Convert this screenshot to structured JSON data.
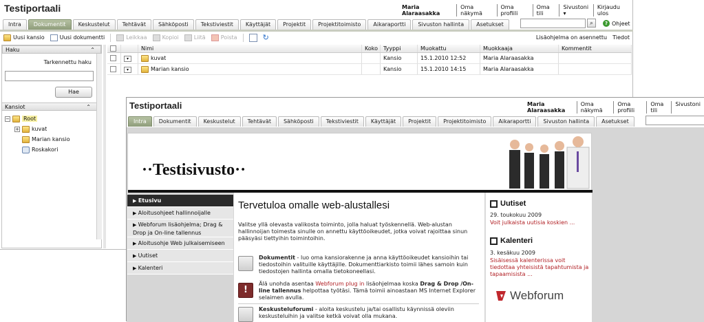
{
  "back": {
    "title": "Testiportaali",
    "user": "Maria Alaraasakka",
    "links": [
      "Oma näkymä",
      "Oma profiili",
      "Oma tili",
      "Sivustoni ▾",
      "Kirjaudu ulos"
    ],
    "tabs": [
      "Intra",
      "Dokumentit",
      "Keskustelut",
      "Tehtävät",
      "Sähköposti",
      "Tekstiviestit",
      "Käyttäjät",
      "Projektit",
      "Projektitoimisto",
      "Aikaraportti",
      "Sivuston hallinta",
      "Asetukset"
    ],
    "active_tab": "Dokumentit",
    "help_label": "Ohjeet",
    "toolbar": {
      "new_folder": "Uusi kansio",
      "new_document": "Uusi dokumentti",
      "cut": "Leikkaa",
      "copy": "Kopioi",
      "paste": "Liitä",
      "delete": "Poista",
      "plugin_status": "Lisäohjelma on asennettu",
      "info": "Tiedot"
    },
    "search_panel": {
      "title": "Haku",
      "advanced": "Tarkennettu haku",
      "search_button": "Hae"
    },
    "folders_panel": {
      "title": "Kansiot",
      "root": "Root",
      "items": [
        "kuvat",
        "Marian kansio",
        "Roskakori"
      ]
    },
    "grid": {
      "columns": [
        "Nimi",
        "Koko",
        "Tyyppi",
        "Muokattu",
        "Muokkaaja",
        "Kommentit"
      ],
      "rows": [
        {
          "name": "kuvat",
          "size": "",
          "type": "Kansio",
          "modified": "15.1.2010 12:52",
          "editor": "Maria Alaraasakka",
          "comment": ""
        },
        {
          "name": "Marian kansio",
          "size": "",
          "type": "Kansio",
          "modified": "15.1.2010 14:15",
          "editor": "Maria Alaraasakka",
          "comment": ""
        }
      ]
    }
  },
  "front": {
    "title": "Testiportaali",
    "user": "Maria Alaraasakka",
    "links": [
      "Oma näkymä",
      "Oma profiili",
      "Oma tili",
      "Sivustoni"
    ],
    "tabs": [
      "Intra",
      "Dokumentit",
      "Keskustelut",
      "Tehtävät",
      "Sähköposti",
      "Tekstiviestit",
      "Käyttäjät",
      "Projektit",
      "Projektitoimisto",
      "Aikaraportti",
      "Sivuston hallinta",
      "Asetukset"
    ],
    "active_tab": "Intra",
    "site_name": "··Testisivusto··",
    "nav": [
      "Etusivu",
      "Aloitusohjeet hallinnoijalle",
      "Webforum lisäohjelma; Drag & Drop ja On-line tallennus",
      "Aloitusohje Web julkaisemiseen",
      "Uutiset",
      "Kalenteri"
    ],
    "welcome_title": "Tervetuloa omalle web-alustallesi",
    "welcome_text": "Valitse yllä olevasta valikosta toiminto, jolla haluat työskennellä. Web-alustan hallinnoijan toimesta sinulle on annettu käyttöoikeudet, jotka voivat rajoittaa sinun pääsyäsi tiettyihin toimintoihin.",
    "sections": [
      {
        "bold": "Dokumentit",
        "text": " - luo oma kansiorakenne ja anna käyttöoikeudet kansioihin tai tiedostoihin valituille käyttäjille. Dokumenttiarkisto toimii lähes samoin kuin tiedostojen hallinta omalla tietokoneellasi."
      },
      {
        "pre": "Älä unohda asentaa ",
        "link": "Webforum plug in",
        "mid": " lisäohjelmaa koska ",
        "bold": "Drag & Drop /On-line tallennus",
        "text": " helpottaa työtäsi. Tämä toimii ainoastaan MS Internet Explorer selaimen avulla."
      },
      {
        "bold": "Keskusteluforumi",
        "text": " - aloita keskustelu ja/tai osallistu käynnissä oleviin keskusteluihin ja valitse ketkä voivat olla mukana."
      }
    ],
    "news": {
      "title": "Uutiset",
      "date": "29. toukokuu 2009",
      "text": "Voit julkaista uutisia koskien ..."
    },
    "calendar": {
      "title": "Kalenteri",
      "date": "3. kesäkuu 2009",
      "text": "Sisäisessä kalenterissa voit tiedottaa yhteisistä tapahtumista ja tapaamisista ..."
    },
    "brand": "Webforum"
  },
  "colors": {
    "active_tab": "#8e9c7a",
    "nav_active": "#2a2a2a",
    "link_red": "#b01d22",
    "brand_red": "#c0272d"
  }
}
